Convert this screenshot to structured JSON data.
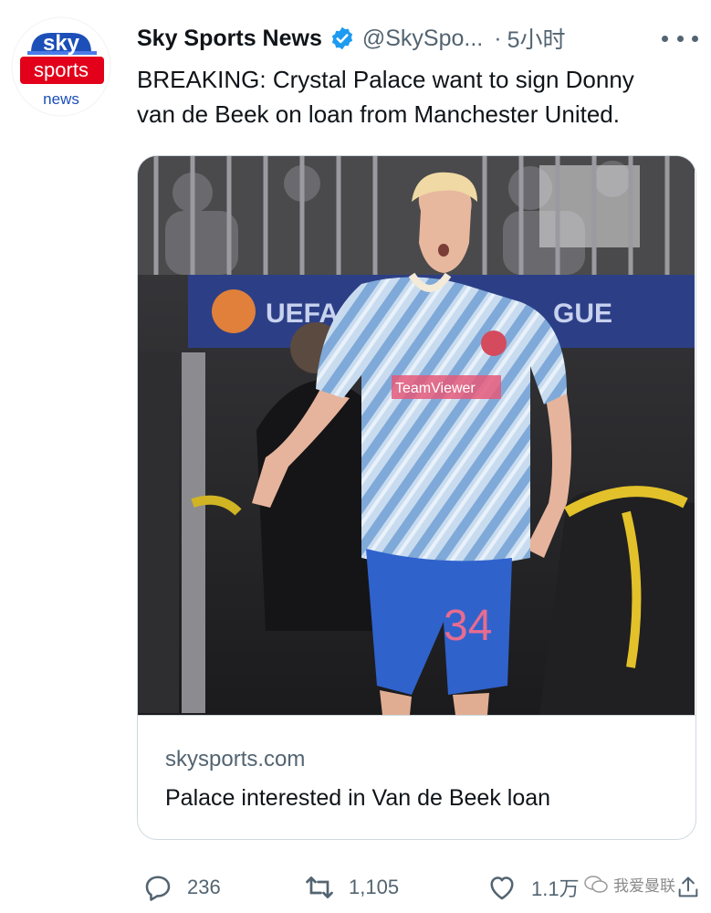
{
  "account": {
    "logo_top": "sky",
    "logo_mid": "sports",
    "logo_bottom": "news",
    "name": "Sky Sports News",
    "handle": "@SkySpo...",
    "separator": "·",
    "time": "5小时"
  },
  "tweet": {
    "text_line1": "BREAKING: Crystal Palace want to sign Donny",
    "text_line2": "van de Beek on loan from Manchester United."
  },
  "card": {
    "image": {
      "banner_text": "UEFA",
      "banner_text_right": "GUE",
      "shirt_sponsor": "TeamViewer",
      "shorts_number": "34"
    },
    "domain": "skysports.com",
    "title": "Palace interested in Van de Beek loan"
  },
  "actions": {
    "replies": "236",
    "retweets": "1,105",
    "likes": "1.1万"
  },
  "watermark": {
    "text": "我爱曼联"
  },
  "colors": {
    "verified_blue": "#1d9bf0",
    "text_primary": "#0f1419",
    "text_secondary": "#536471",
    "border": "#cfd9de",
    "sky_red": "#e2001a"
  }
}
